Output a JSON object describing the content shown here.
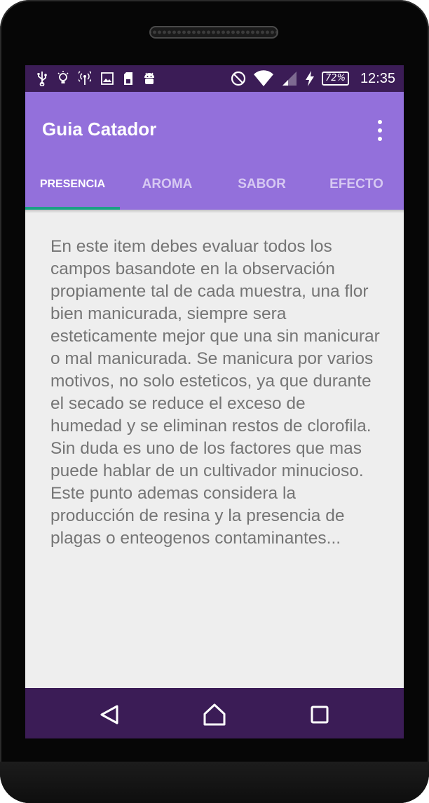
{
  "status_bar": {
    "icons_left": [
      "usb-icon",
      "lightbulb-icon",
      "hotspot-icon",
      "image-icon",
      "sd-card-icon",
      "android-icon"
    ],
    "icons_right": [
      "do-not-disturb-icon",
      "wifi-icon",
      "cell-signal-icon",
      "charging-icon"
    ],
    "battery": "72%",
    "time": "12:35"
  },
  "app_bar": {
    "title": "Guia Catador",
    "menu_icon": "more-vert-icon"
  },
  "tabs": [
    {
      "label": "PRESENCIA",
      "active": true
    },
    {
      "label": "AROMA",
      "active": false
    },
    {
      "label": "SABOR",
      "active": false
    },
    {
      "label": "EFECTO",
      "active": false
    }
  ],
  "content": {
    "text": "En este item debes evaluar todos los campos basandote en la observación propiamente tal de cada muestra, una flor bien manicurada, siempre sera esteticamente mejor que una sin manicurar o mal manicurada. Se manicura por varios motivos, no solo esteticos, ya que durante el secado se reduce el exceso de humedad y se eliminan restos de clorofila. Sin duda es uno de los factores que mas puede hablar de un cultivador minucioso. Este punto ademas considera la producción de resina y la presencia de plagas o enteogenos contaminantes..."
  },
  "nav_bar": {
    "buttons": [
      "back-icon",
      "home-icon",
      "recents-icon"
    ]
  },
  "colors": {
    "status_bar": "#3b1c56",
    "app_bar": "#9370db",
    "tab_indicator": "#1aa085",
    "content_bg": "#eeeeee",
    "body_text": "#757575"
  }
}
